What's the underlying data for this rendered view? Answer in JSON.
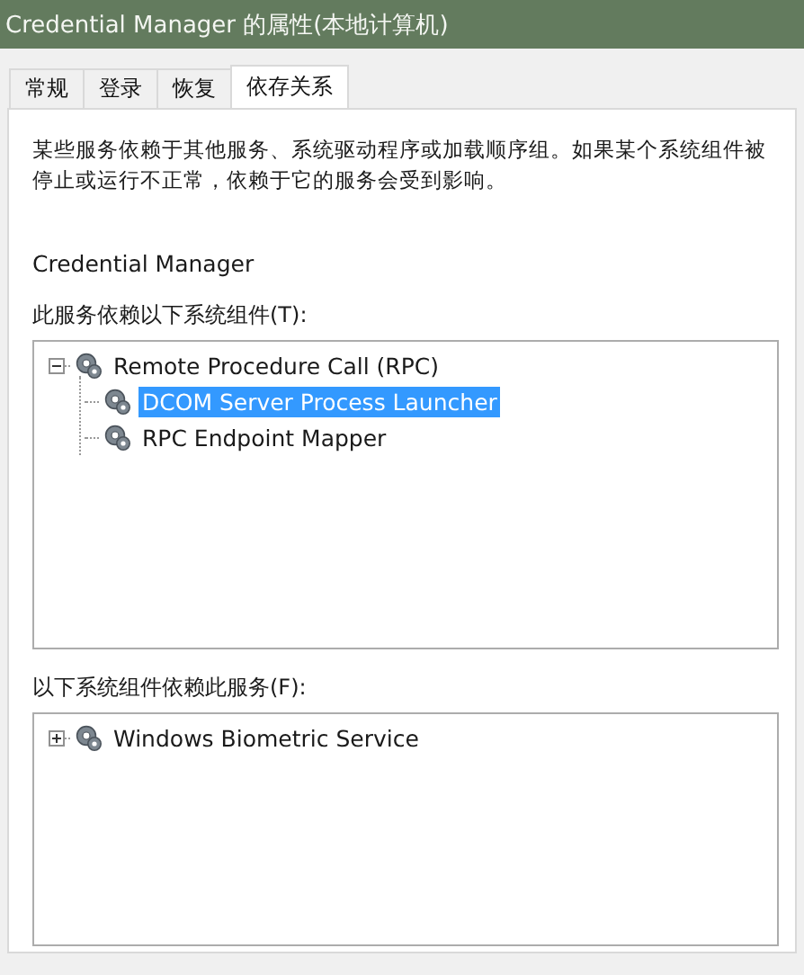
{
  "window": {
    "title": "Credential Manager 的属性(本地计算机)"
  },
  "tabs": [
    {
      "label": "常规",
      "selected": false
    },
    {
      "label": "登录",
      "selected": false
    },
    {
      "label": "恢复",
      "selected": false
    },
    {
      "label": "依存关系",
      "selected": true
    }
  ],
  "description": "某些服务依赖于其他服务、系统驱动程序或加载顺序组。如果某个系统组件被停止或运行不正常，依赖于它的服务会受到影响。",
  "service_name": "Credential Manager",
  "depends_on": {
    "label": "此服务依赖以下系统组件(T):",
    "items": [
      {
        "name": "Remote Procedure Call (RPC)",
        "expanded": true,
        "selected": false,
        "children": [
          {
            "name": "DCOM Server Process Launcher",
            "selected": true
          },
          {
            "name": "RPC Endpoint Mapper",
            "selected": false
          }
        ]
      }
    ]
  },
  "dependents": {
    "label": "以下系统组件依赖此服务(F):",
    "items": [
      {
        "name": "Windows Biometric Service",
        "expanded": false,
        "selected": false
      }
    ]
  }
}
